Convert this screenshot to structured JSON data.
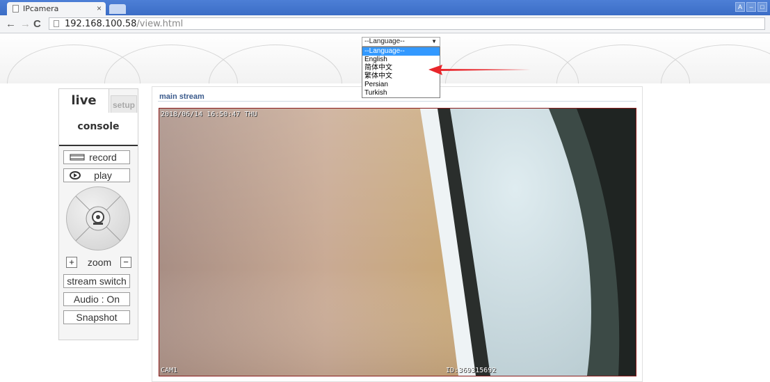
{
  "browser": {
    "tab_title": "IPcamera",
    "tab_close": "×",
    "url_host": "192.168.100.58",
    "url_path": "/view.html",
    "win_controls": [
      "A",
      "–",
      "□"
    ]
  },
  "language": {
    "selected": "--Language--",
    "options": [
      "--Language--",
      "English",
      "简体中文",
      "繁体中文",
      "Persian",
      "Turkish"
    ],
    "highlighted_index": 0
  },
  "annotation": {
    "arrow_color": "#e8262b"
  },
  "left_panel": {
    "tab_live": "live",
    "tab_setup": "setup",
    "console": "console",
    "record": "record",
    "play": "play",
    "zoom": "zoom",
    "stream_switch": "stream switch",
    "audio": "Audio : On",
    "snapshot": "Snapshot"
  },
  "main": {
    "title": "main stream",
    "osd_time": "2018/06/14 16:50:47 THU",
    "osd_cam": "CAM1",
    "osd_id": "ID:369315692"
  },
  "colors": {
    "accent_blue": "#3b6dc6",
    "selection_blue": "#3399ff",
    "title_blue": "#3a5a8c"
  }
}
